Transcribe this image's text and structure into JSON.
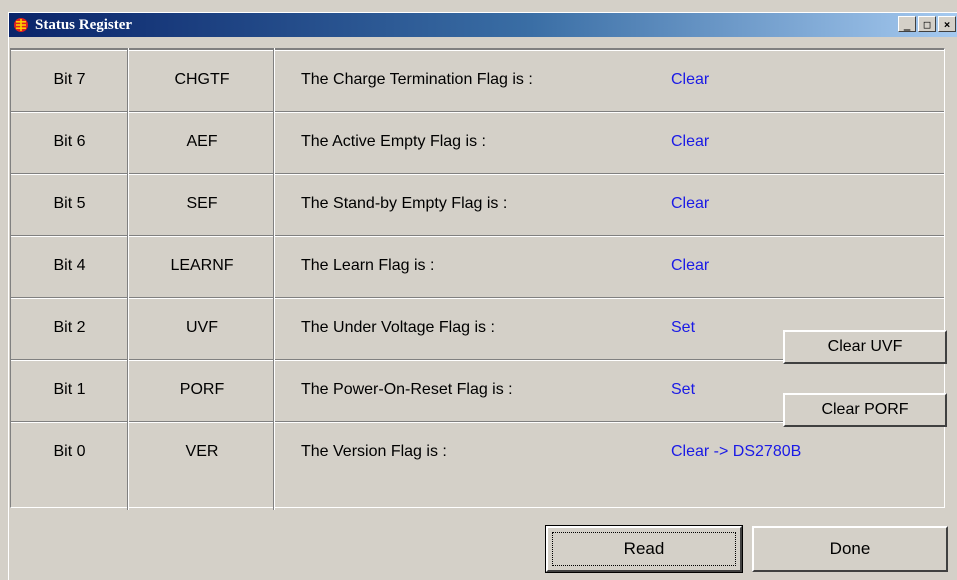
{
  "window": {
    "title": "Status Register",
    "controls": {
      "minimize": "_",
      "maximize": "□",
      "close": "×"
    }
  },
  "rows": [
    {
      "bit": "Bit 7",
      "name": "CHGTF",
      "desc": "The Charge Termination Flag is :",
      "value": "Clear"
    },
    {
      "bit": "Bit 6",
      "name": "AEF",
      "desc": "The Active Empty Flag  is :",
      "value": "Clear"
    },
    {
      "bit": "Bit 5",
      "name": "SEF",
      "desc": "The Stand-by Empty Flag  is :",
      "value": "Clear"
    },
    {
      "bit": "Bit 4",
      "name": "LEARNF",
      "desc": "The Learn Flag is :",
      "value": "Clear"
    },
    {
      "bit": "Bit 2",
      "name": "UVF",
      "desc": "The Under Voltage Flag is :",
      "value": "Set"
    },
    {
      "bit": "Bit 1",
      "name": "PORF",
      "desc": "The Power-On-Reset Flag is :",
      "value": "Set"
    },
    {
      "bit": "Bit 0",
      "name": "VER",
      "desc": "The Version Flag is :",
      "value": "Clear -> DS2780B"
    }
  ],
  "buttons": {
    "clear_uvf": "Clear UVF",
    "clear_porf": "Clear PORF",
    "read": "Read",
    "done": "Done"
  },
  "colors": {
    "value_text": "#1a1ae6",
    "dialog_bg": "#d4d0c8",
    "titlebar": "#0a246a"
  }
}
